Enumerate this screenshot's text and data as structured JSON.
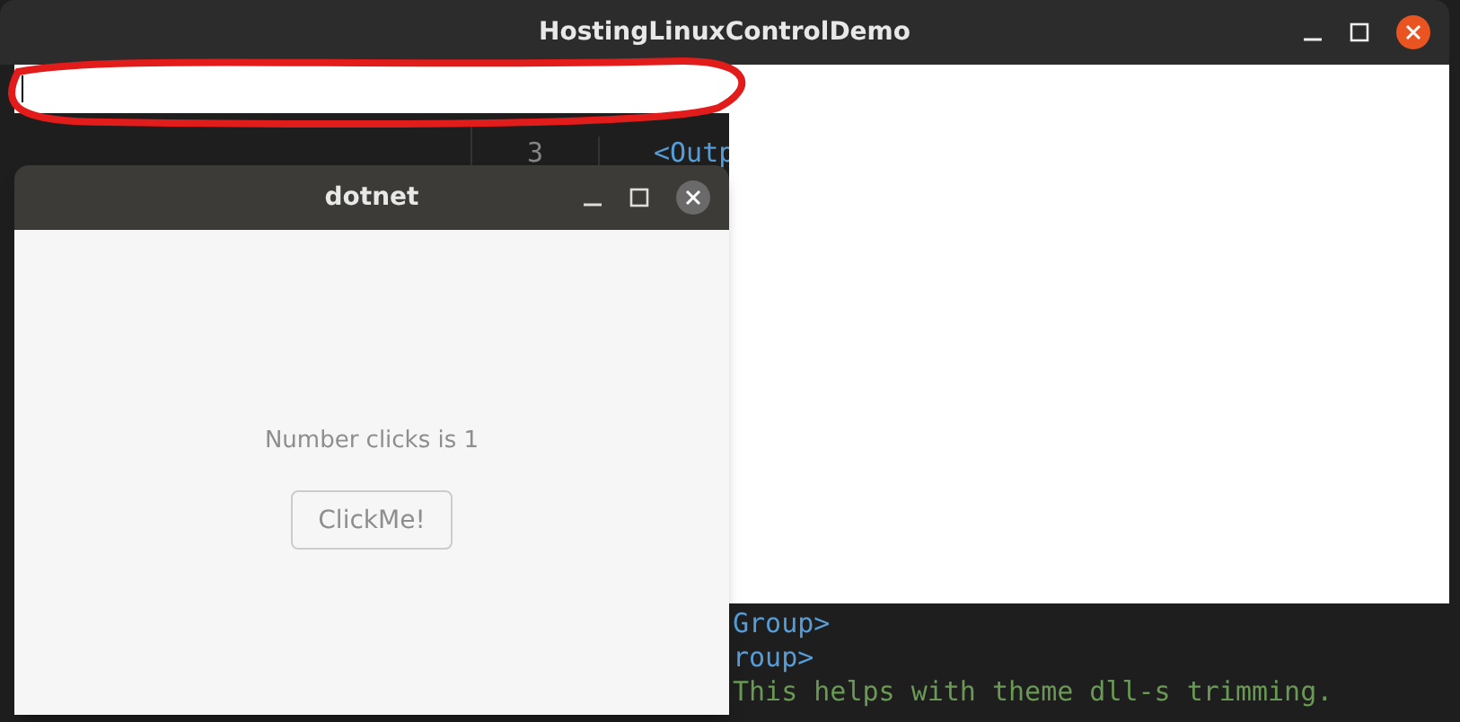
{
  "editor": {
    "gutter_line": {
      "number": "3",
      "text": "<Outp"
    },
    "lines": [
      {
        "text": "Group>",
        "kind": "tag"
      },
      {
        "text": "roup>",
        "kind": "tag"
      },
      {
        "text": "This helps with theme dll-s trimming.",
        "kind": "comment"
      }
    ]
  },
  "main_window": {
    "title": "HostingLinuxControlDemo",
    "text_field": {
      "focused": true
    }
  },
  "dotnet_window": {
    "title": "dotnet",
    "label": "Number clicks is 1",
    "button": "ClickMe!"
  }
}
